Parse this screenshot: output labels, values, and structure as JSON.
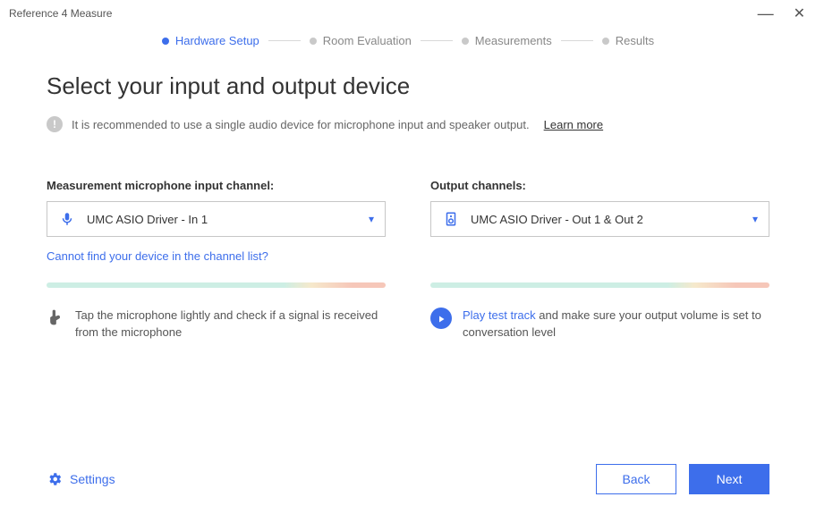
{
  "window": {
    "title": "Reference 4 Measure"
  },
  "stepper": {
    "steps": [
      "Hardware Setup",
      "Room Evaluation",
      "Measurements",
      "Results"
    ],
    "active_index": 0
  },
  "heading": "Select your input and output device",
  "info": {
    "text": "It is recommended to use a single audio device for microphone input and speaker output.",
    "learn_more": "Learn more"
  },
  "input_section": {
    "label": "Measurement microphone input channel:",
    "selected": "UMC ASIO Driver - In 1",
    "cannot_find": "Cannot find your device in the channel list?",
    "tip": "Tap the microphone lightly and check if a signal is received from the microphone"
  },
  "output_section": {
    "label": "Output channels:",
    "selected": "UMC ASIO Driver - Out 1 & Out 2",
    "play_link": "Play test track",
    "tip_suffix": " and make sure your output volume is set to conversation level"
  },
  "footer": {
    "settings": "Settings",
    "back": "Back",
    "next": "Next"
  }
}
